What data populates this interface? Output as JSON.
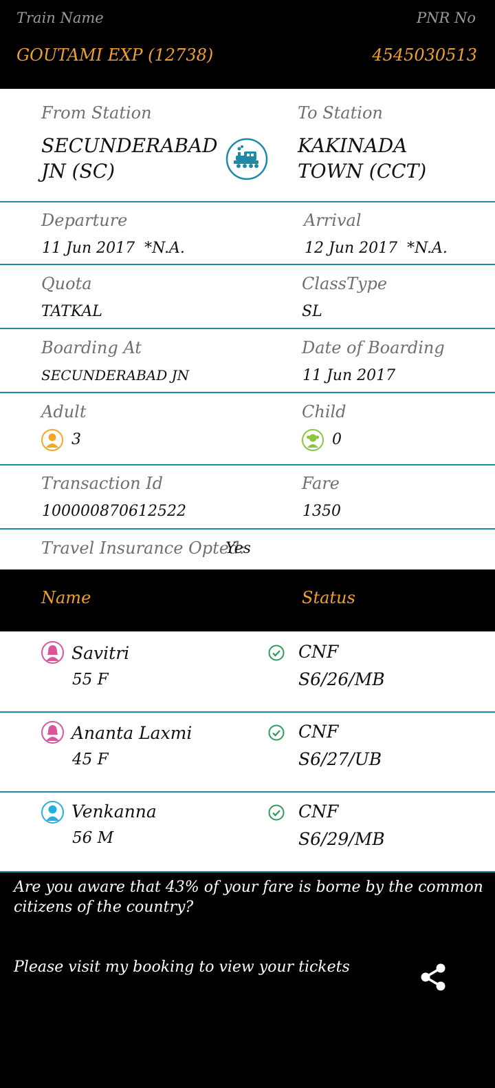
{
  "header": {
    "train_name_label": "Train Name",
    "pnr_label": "PNR No",
    "train_name": "GOUTAMI EXP (12738)",
    "pnr": "4545030513"
  },
  "route": {
    "from_label": "From Station",
    "from_line1": "SECUNDERABAD",
    "from_line2": "JN (SC)",
    "to_label": "To Station",
    "to_line1": "KAKINADA",
    "to_line2": "TOWN (CCT)",
    "icon": "train-icon"
  },
  "details": {
    "departure_label": "Departure",
    "departure": "11 Jun 2017  *N.A.",
    "arrival_label": "Arrival",
    "arrival": "12 Jun 2017  *N.A.",
    "quota_label": "Quota",
    "quota": "TATKAL",
    "class_label": "ClassType",
    "class": "SL",
    "boarding_label": "Boarding At",
    "boarding": "SECUNDERABAD JN",
    "boarding_date_label": "Date of Boarding",
    "boarding_date": "11 Jun 2017",
    "adult_label": "Adult",
    "adult": "3",
    "child_label": "Child",
    "child": "0",
    "txn_label": "Transaction Id",
    "txn": "100000870612522",
    "fare_label": "Fare",
    "fare": "1350",
    "insurance_label": "Travel Insurance Opted:",
    "insurance": "Yes"
  },
  "passenger_header": {
    "name": "Name",
    "status": "Status"
  },
  "passengers": [
    {
      "name": "Savitri",
      "detail": "55 F",
      "status": "CNF",
      "berth": "S6/26/MB"
    },
    {
      "name": "Ananta Laxmi",
      "detail": "45 F",
      "status": "CNF",
      "berth": "S6/27/UB"
    },
    {
      "name": "Venkanna",
      "detail": "56 M",
      "status": "CNF",
      "berth": "S6/29/MB"
    }
  ],
  "footer": {
    "notice": "Are you aware that 43% of your fare is borne by the common citizens of the country?",
    "visit": "Please visit my booking to view your tickets"
  },
  "colors": {
    "accent": "#f0a02c",
    "divider": "#1f8aa6",
    "female": "#d9569a",
    "male": "#29aee0",
    "child": "#8cc63f",
    "adult": "#f5a623",
    "confirmed": "#2e9b5a"
  }
}
